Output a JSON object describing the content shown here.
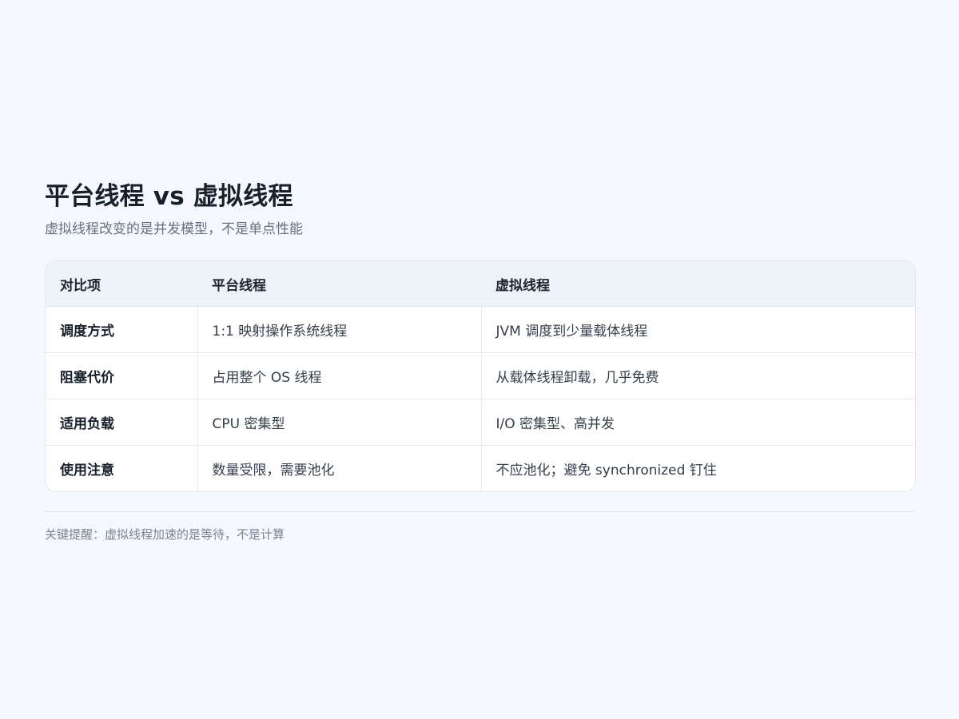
{
  "header": {
    "title": "平台线程 vs 虚拟线程",
    "subtitle": "虚拟线程改变的是并发模型，不是单点性能"
  },
  "table": {
    "columns": [
      "对比项",
      "平台线程",
      "虚拟线程"
    ],
    "rows": [
      [
        "调度方式",
        "1:1 映射操作系统线程",
        "JVM 调度到少量载体线程"
      ],
      [
        "阻塞代价",
        "占用整个 OS 线程",
        "从载体线程卸载，几乎免费"
      ],
      [
        "适用负载",
        "CPU 密集型",
        "I/O 密集型、高并发"
      ],
      [
        "使用注意",
        "数量受限，需要池化",
        "不应池化；避免 synchronized 钉住"
      ]
    ]
  },
  "footer": {
    "note": "关键提醒：虚拟线程加速的是等待，不是计算"
  }
}
